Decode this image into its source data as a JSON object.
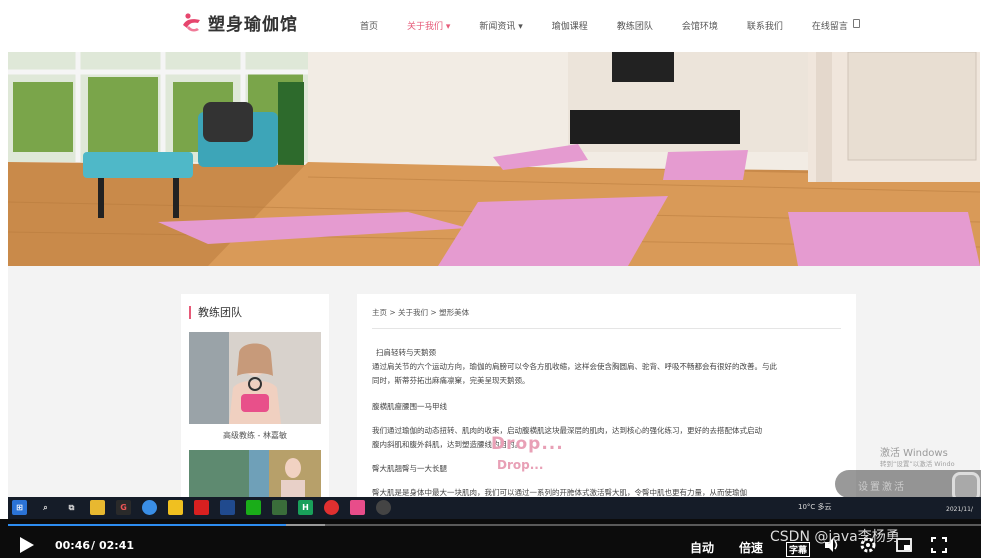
{
  "header": {
    "logo_text": "塑身瑜伽馆",
    "nav": [
      {
        "label": "首页"
      },
      {
        "label": "关于我们 ▾",
        "active": true
      },
      {
        "label": "新闻资讯 ▾"
      },
      {
        "label": "瑜伽课程"
      },
      {
        "label": "教练团队"
      },
      {
        "label": "会馆环境"
      },
      {
        "label": "联系我们"
      },
      {
        "label": "在线留言"
      }
    ]
  },
  "sidebar": {
    "title": "教练团队",
    "coach_caption": "高级教练 - 林嘉敏"
  },
  "article": {
    "breadcrumb": "主页 > 关于我们 > 塑形美体",
    "lines": [
      "扫肩轻转与天鹅颈",
      "通过肩关节的六个运动方向，瑜伽的肩膀可以令各方肌收缩，这样会使含胸圆肩、驼背、呼吸不畅都会有很好的改善。与此",
      "同时，斯蒂芬拓出麻痛凛窠，完美呈现天鹅颈。",
      "腹横肌瘦腰围一马甲线",
      "我们通过瑜伽的动态扭转、肌肉的收束，启动腹横肌这块最深层的肌肉，达到核心的强化练习，更好的去搭配体式启动",
      "腹内斜肌和腹外斜肌，达到塑造腰线的目的。",
      "臀大肌翘臀与一大长腿",
      "臀大肌是是身体中最大一块肌肉，我们可以通过一系列的开胯体式激活臀大肌，令臀中肌也更有力量，从而使瑜伽"
    ]
  },
  "overlay": {
    "drop_large": "Drop...",
    "drop_small": "Drop...",
    "windows_title": "激活 Windows",
    "windows_sub": "转到“设置”以激活 Windo",
    "blob_text": "设置激活"
  },
  "taskbar": {
    "weather": "10°C 多云",
    "clock": "2021/11/"
  },
  "player": {
    "current_time": "00:46",
    "separator": "/",
    "total_time": "02:41",
    "progress": 0.286,
    "auto_label": "自动",
    "speed_label": "倍速",
    "subtitle_label": "字幕"
  },
  "watermark": "CSDN @java李杨勇"
}
